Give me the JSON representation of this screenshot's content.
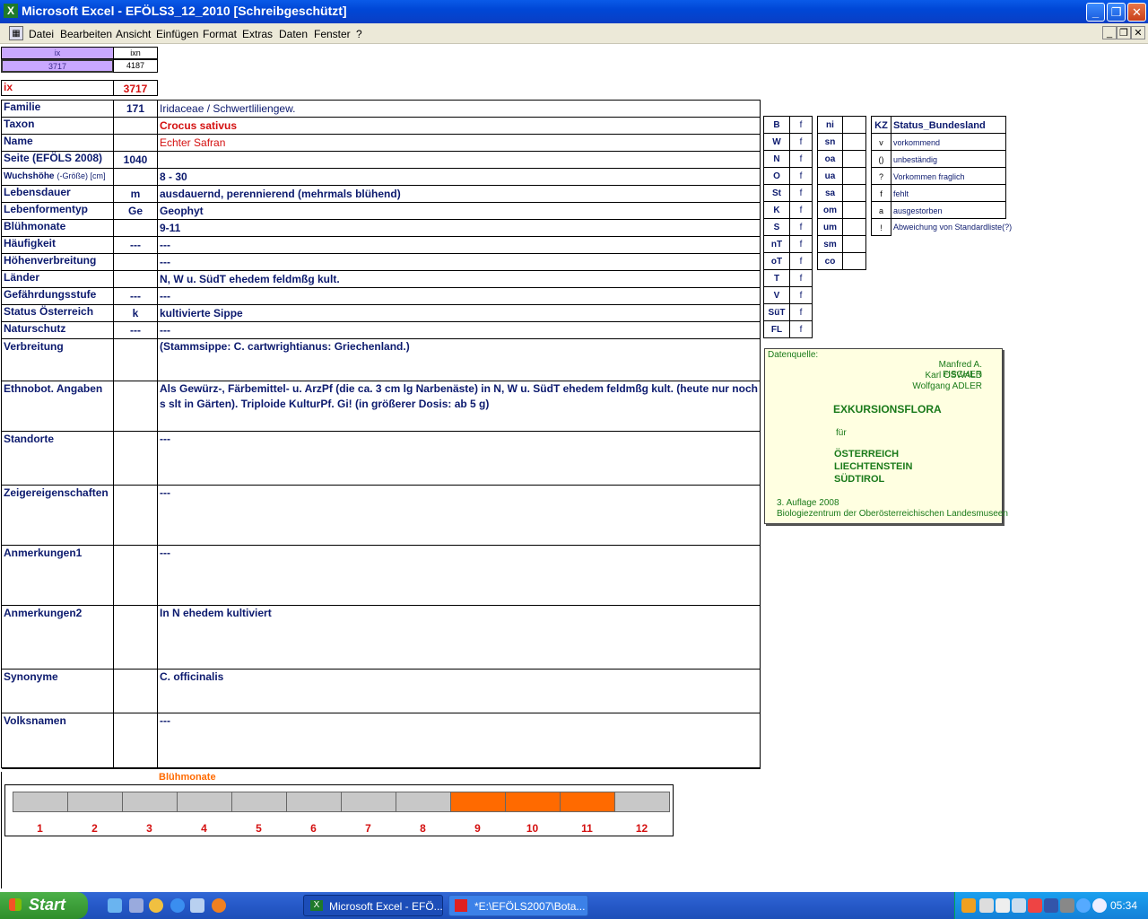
{
  "window": {
    "title": "Microsoft Excel - EFÖLS3_12_2010  [Schreibgeschützt]",
    "app_icon": "excel-icon"
  },
  "menu": [
    "Datei",
    "Bearbeiten",
    "Ansicht",
    "Einfügen",
    "Format",
    "Extras",
    "Daten",
    "Fenster",
    "?"
  ],
  "header": {
    "ix_label": "ix",
    "ixn_label": "ixn",
    "ix_value": "3717",
    "ixn_value": "4187",
    "ix_big_label": "ix",
    "ix_big_value": "3717"
  },
  "rows": [
    {
      "label": "Familie",
      "code": "171",
      "text": "Iridaceae  /  Schwertliliengew."
    },
    {
      "label": "Taxon",
      "code": "",
      "text": "Crocus sativus"
    },
    {
      "label": "Name",
      "code": "",
      "text": "Echter Safran"
    },
    {
      "label": "Seite (EFÖLS 2008)",
      "code": "1040",
      "text": ""
    },
    {
      "label": "Wuchshöhe",
      "label_small": "(-Größe) [cm]",
      "code": "",
      "text": " 8 - 30"
    },
    {
      "label": "Lebensdauer",
      "code": "m",
      "text": "ausdauernd, perennierend (mehrmals blühend)"
    },
    {
      "label": "Lebenformentyp",
      "code": "Ge",
      "text": "Geophyt"
    },
    {
      "label": "Blühmonate",
      "code": "",
      "text": " 9-11"
    },
    {
      "label": "Häufigkeit",
      "code": "---",
      "text": " ---"
    },
    {
      "label": "Höhenverbreitung",
      "code": "",
      "text": " ---"
    },
    {
      "label": "Länder",
      "code": "",
      "text": "N, W u. SüdT ehedem feldmßg kult."
    },
    {
      "label": "Gefährdungsstufe",
      "code": "---",
      "text": "   ---"
    },
    {
      "label": "Status Österreich",
      "code": "k",
      "text": "kultivierte Sippe"
    },
    {
      "label": "Naturschutz",
      "code": "---",
      "text": " ---"
    },
    {
      "label": "Verbreitung",
      "code": "",
      "text": "(Stammsippe: C. cartwrightianus: Griechenland.)"
    },
    {
      "label": "Ethnobot. Angaben",
      "code": "",
      "text": "Als Gewürz-, Färbemittel- u. ArzPf (die ca. 3 cm lg Narbenäste) in N, W u. SüdT ehedem feldmßg kult. (heute nur noch s slt in Gärten). Triploide KulturPf.  Gi! (in größerer Dosis: ab 5 g)"
    },
    {
      "label": "Standorte",
      "code": "",
      "text": "---"
    },
    {
      "label": "Zeigereigenschaften",
      "code": "",
      "text": "---"
    },
    {
      "label": "Anmerkungen1",
      "code": "",
      "text": "---"
    },
    {
      "label": "Anmerkungen2",
      "code": "",
      "text": "In N ehedem kultiviert"
    },
    {
      "label": "Synonyme",
      "code": "",
      "text": "C. officinalis"
    },
    {
      "label": "Volksnamen",
      "code": "",
      "text": "---"
    }
  ],
  "regions": [
    {
      "code": "B",
      "val": "f"
    },
    {
      "code": "W",
      "val": "f"
    },
    {
      "code": "N",
      "val": "f"
    },
    {
      "code": "O",
      "val": "f"
    },
    {
      "code": "St",
      "val": "f"
    },
    {
      "code": "K",
      "val": "f"
    },
    {
      "code": "S",
      "val": "f"
    },
    {
      "code": "nT",
      "val": "f"
    },
    {
      "code": "oT",
      "val": "f"
    },
    {
      "code": "T",
      "val": "f"
    },
    {
      "code": "V",
      "val": "f"
    },
    {
      "code": "SüT",
      "val": "f"
    },
    {
      "code": "FL",
      "val": "f"
    }
  ],
  "altitude": [
    "ni",
    "sn",
    "oa",
    "ua",
    "sa",
    "om",
    "um",
    "sm",
    "co"
  ],
  "status_legend": {
    "head_kz": "KZ",
    "head_status": "Status_Bundesland",
    "items": [
      {
        "kz": "v",
        "text": "vorkommend"
      },
      {
        "kz": "()",
        "text": "unbeständig"
      },
      {
        "kz": "?",
        "text": "Vorkommen fraglich"
      },
      {
        "kz": "f",
        "text": "fehlt"
      },
      {
        "kz": "a",
        "text": "ausgestorben"
      },
      {
        "kz": "!",
        "text": "Abweichung von Standardliste(?)"
      }
    ]
  },
  "source": {
    "label": "Datenquelle:",
    "authors": [
      "Manfred A. FISCHER",
      "Karl OSWALD",
      "Wolfgang ADLER"
    ],
    "title": "EXKURSIONSFLORA",
    "fuer": "für",
    "countries": [
      "ÖSTERREICH",
      "LIECHTENSTEIN",
      "SÜDTIROL"
    ],
    "edition": "3. Auflage 2008",
    "publisher": "Biologiezentrum der Oberösterreichischen Landesmuseen"
  },
  "chart_data": {
    "type": "bar",
    "title": "Blühmonate",
    "categories": [
      "1",
      "2",
      "3",
      "4",
      "5",
      "6",
      "7",
      "8",
      "9",
      "10",
      "11",
      "12"
    ],
    "values": [
      0,
      0,
      0,
      0,
      0,
      0,
      0,
      0,
      1,
      1,
      1,
      0
    ],
    "colors": {
      "on": "#ff6a00",
      "off": "#c8c8c8"
    }
  },
  "taskbar": {
    "start": "Start",
    "tasks": [
      "Microsoft Excel - EFÖ...",
      "*E:\\EFÖLS2007\\Bota..."
    ],
    "clock": "05:34"
  }
}
